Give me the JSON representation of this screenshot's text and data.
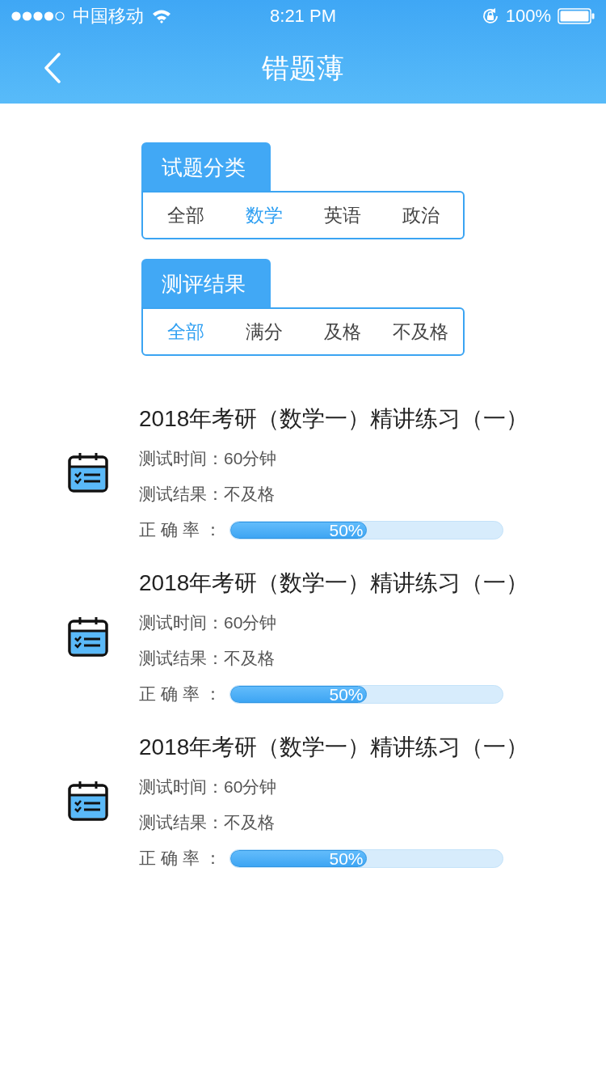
{
  "status_bar": {
    "carrier": "中国移动",
    "time": "8:21 PM",
    "battery": "100%"
  },
  "nav": {
    "title": "错题薄"
  },
  "filters": [
    {
      "label": "试题分类",
      "options": [
        {
          "label": "全部",
          "selected": false
        },
        {
          "label": "数学",
          "selected": true
        },
        {
          "label": "英语",
          "selected": false
        },
        {
          "label": "政治",
          "selected": false
        }
      ]
    },
    {
      "label": "测评结果",
      "options": [
        {
          "label": "全部",
          "selected": true
        },
        {
          "label": "满分",
          "selected": false
        },
        {
          "label": "及格",
          "selected": false
        },
        {
          "label": "不及格",
          "selected": false
        }
      ]
    }
  ],
  "records": [
    {
      "title": "2018年考研（数学一）精讲练习（一）",
      "duration": "测试时间：60分钟",
      "result": "测试结果：不及格",
      "accuracy_label": "正 确 率 ：",
      "level": 0.5,
      "reading": "50%"
    },
    {
      "title": "2018年考研（数学一）精讲练习（一）",
      "duration": "测试时间：60分钟",
      "result": "测试结果：不及格",
      "accuracy_label": "正 确 率 ：",
      "level": 0.5,
      "reading": "50%"
    },
    {
      "title": "2018年考研（数学一）精讲练习（一）",
      "duration": "测试时间：60分钟",
      "result": "测试结果：不及格",
      "accuracy_label": "正 确 率 ：",
      "level": 0.5,
      "reading": "50%"
    }
  ]
}
